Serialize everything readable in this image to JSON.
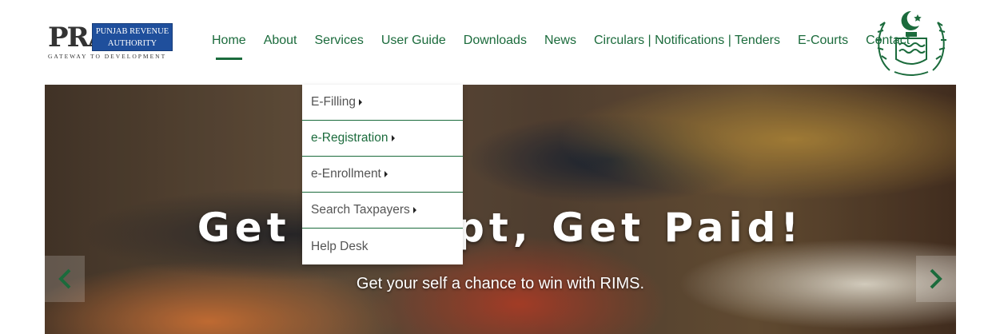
{
  "header": {
    "logo": {
      "mark": "PRA",
      "name_line1": "PUNJAB REVENUE",
      "name_line2": "AUTHORITY",
      "tagline": "GATEWAY TO DEVELOPMENT",
      "color": "#1f4f9c"
    },
    "nav": [
      {
        "label": "Home",
        "active": true
      },
      {
        "label": "About"
      },
      {
        "label": "Services"
      },
      {
        "label": "User Guide"
      },
      {
        "label": "Downloads"
      },
      {
        "label": "News"
      },
      {
        "label": "Circulars | Notifications | Tenders"
      },
      {
        "label": "E-Courts"
      },
      {
        "label": "Contact"
      }
    ],
    "accent_color": "#1b6b3c",
    "emblem_icon": "government-of-punjab-emblem-icon"
  },
  "services_menu": [
    {
      "label": "E-Filling",
      "has_submenu": true
    },
    {
      "label": "e-Registration",
      "has_submenu": true,
      "highlighted": true
    },
    {
      "label": "e-Enrollment",
      "has_submenu": true
    },
    {
      "label": "Search Taxpayers",
      "has_submenu": true
    },
    {
      "label": "Help Desk",
      "has_submenu": false
    }
  ],
  "hero": {
    "title": "Get Receipt, Get Paid!",
    "subtitle": "Get your self a chance to win with RIMS.",
    "prev_icon": "chevron-left-icon",
    "next_icon": "chevron-right-icon"
  }
}
